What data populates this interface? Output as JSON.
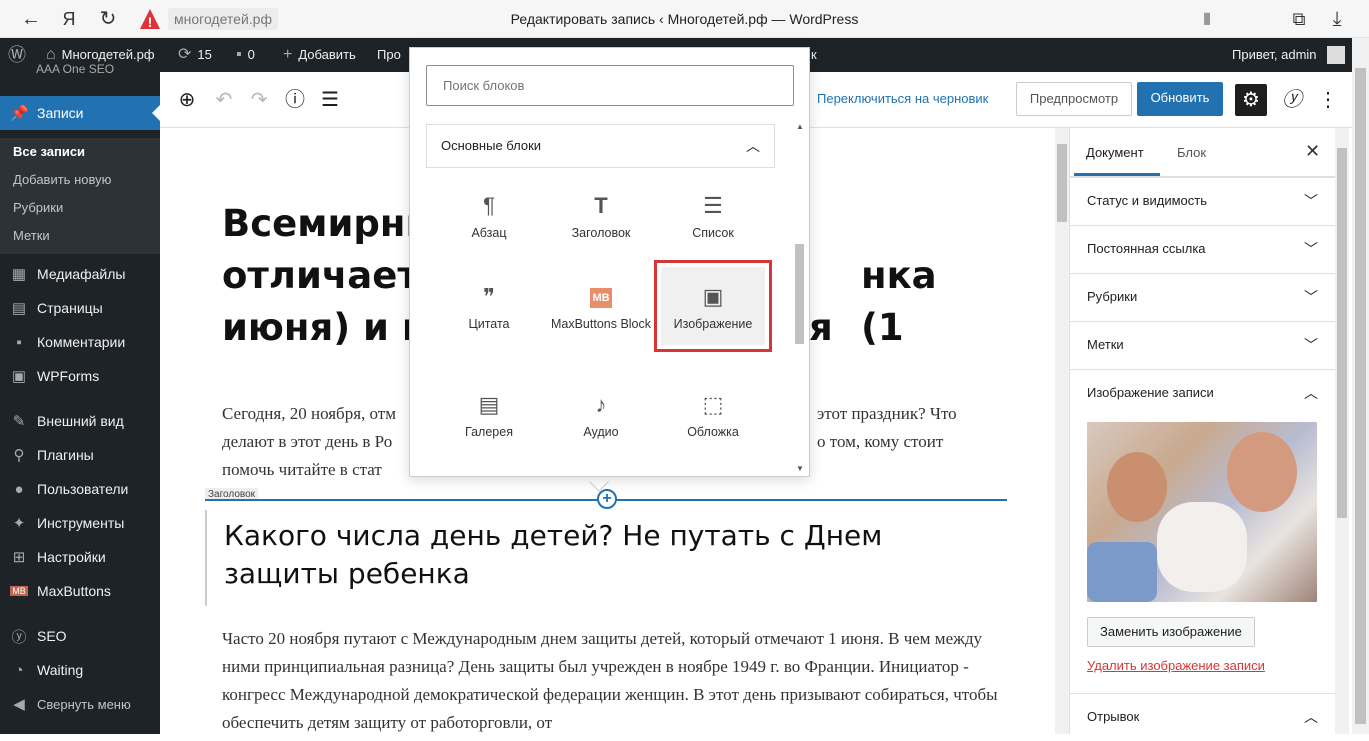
{
  "browser": {
    "url": "многодетей.рф",
    "tab_title": "Редактировать запись ‹ Многодетей.рф — WordPress",
    "back_icon": "arrow-left",
    "yandex_logo": "Я",
    "reload_icon": "reload"
  },
  "adminbar": {
    "site_name": "Многодетей.рф",
    "updates_count": "15",
    "comments_count": "0",
    "add_label": "Добавить",
    "view_label": "Про",
    "hidden_right_suffix": "к",
    "greeting": "Привет, admin"
  },
  "sidebar": {
    "partial_top": "AAA One SEO",
    "posts_label": "Записи",
    "submenu": [
      {
        "label": "Все записи"
      },
      {
        "label": "Добавить новую"
      },
      {
        "label": "Рубрики"
      },
      {
        "label": "Метки"
      }
    ],
    "items": [
      {
        "label": "Медиафайлы",
        "icon": "media-icon"
      },
      {
        "label": "Страницы",
        "icon": "pages-icon"
      },
      {
        "label": "Комментарии",
        "icon": "comments-icon"
      },
      {
        "label": "WPForms",
        "icon": "wpforms-icon"
      },
      {
        "label": "Внешний вид",
        "icon": "appearance-icon"
      },
      {
        "label": "Плагины",
        "icon": "plugins-icon"
      },
      {
        "label": "Пользователи",
        "icon": "users-icon"
      },
      {
        "label": "Инструменты",
        "icon": "tools-icon"
      },
      {
        "label": "Настройки",
        "icon": "settings-icon"
      },
      {
        "label": "MaxButtons",
        "icon": "maxbuttons-icon"
      },
      {
        "label": "SEO",
        "icon": "yoast-icon"
      },
      {
        "label": "Waiting",
        "icon": "waiting-icon"
      },
      {
        "label": "Свернуть меню",
        "icon": "collapse-icon"
      }
    ]
  },
  "toolbar": {
    "switch_draft": "Переключиться на черновик",
    "preview": "Предпросмотр",
    "update": "Обновить"
  },
  "inserter": {
    "search_placeholder": "Поиск блоков",
    "panel_title": "Основные блоки",
    "blocks": [
      {
        "label": "Абзац",
        "icon": "¶"
      },
      {
        "label": "Заголовок",
        "icon": "T"
      },
      {
        "label": "Список",
        "icon": "☰"
      },
      {
        "label": "Цитата",
        "icon": "❞"
      },
      {
        "label": "MaxButtons Block",
        "icon": "MB"
      },
      {
        "label": "Изображение",
        "icon": "▣"
      },
      {
        "label": "Галерея",
        "icon": "▤"
      },
      {
        "label": "Аудио",
        "icon": "♪"
      },
      {
        "label": "Обложка",
        "icon": "⬚"
      }
    ]
  },
  "post": {
    "title_line1": "Всемирны",
    "title_line1_end": "",
    "title_line2": "отличаетс",
    "title_line2_end": "нка (1",
    "title_line3": "июня) и к",
    "title_line3_end": "я",
    "intro_line1": "Сегодня, 20 ноября, отм",
    "intro_line1_end": "этот праздник? Что",
    "intro_line2": "делают в этот день в Ро",
    "intro_line2_end": "о том, кому стоит",
    "intro_line3": "помочь читайте в стат",
    "heading_tag": "Заголовок",
    "heading": "Какого числа день детей? Не путать с Днем защиты ребенка",
    "body": "Часто 20 ноября путают с Международным днем защиты детей, который отмечают 1 июня. В чем между ними принципиальная разница? День защиты был учрежден в ноябре 1949 г. во Франции. Инициатор - конгресс Международной демократической федерации женщин. В этот день призывают собираться, чтобы обеспечить детям защиту от работорговли, от"
  },
  "settings": {
    "tab_document": "Документ",
    "tab_block": "Блок",
    "panels": [
      {
        "label": "Статус и видимость"
      },
      {
        "label": "Постоянная ссылка"
      },
      {
        "label": "Рубрики"
      },
      {
        "label": "Метки"
      },
      {
        "label": "Изображение записи"
      }
    ],
    "replace_image": "Заменить изображение",
    "remove_image": "Удалить изображение записи",
    "excerpt": "Отрывок"
  },
  "colors": {
    "admin_dark": "#1d2327",
    "accent": "#2271b1",
    "highlight_red": "#d63638"
  }
}
